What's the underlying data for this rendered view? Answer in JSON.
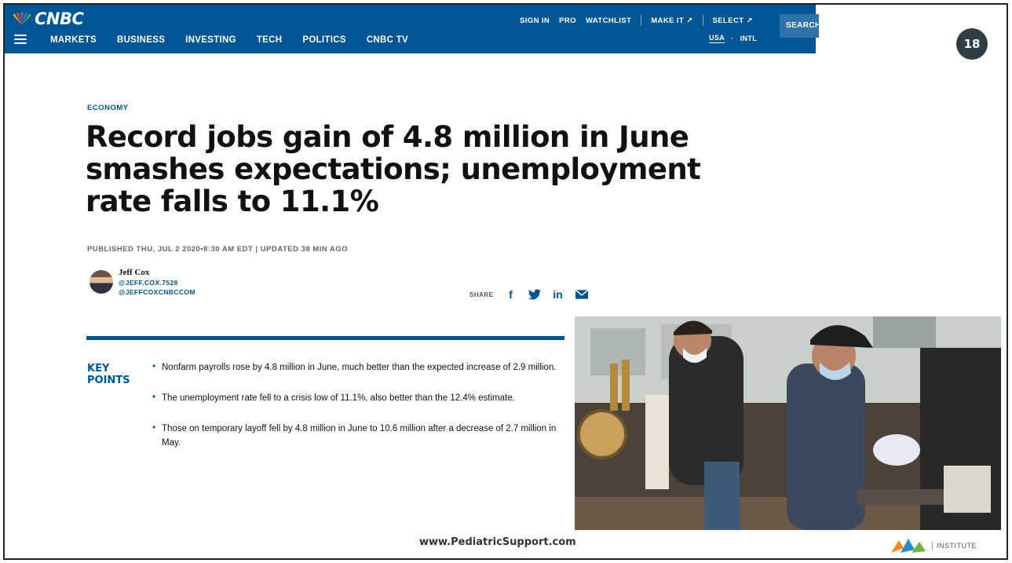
{
  "slide": {
    "number": "18",
    "footer_url": "www.PediatricSupport.com",
    "institute_label": "INSTITUTE"
  },
  "header": {
    "brand": "CNBC",
    "nav": [
      "MARKETS",
      "BUSINESS",
      "INVESTING",
      "TECH",
      "POLITICS",
      "CNBC TV"
    ],
    "top_links": [
      "SIGN IN",
      "PRO",
      "WATCHLIST",
      "MAKE IT ↗",
      "SELECT ↗"
    ],
    "search_label": "SEARCH",
    "regions": [
      "USA",
      "·",
      "INTL"
    ]
  },
  "article": {
    "section": "ECONOMY",
    "headline": "Record jobs gain of 4.8 million in June smashes expectations; unemployment rate falls to 11.1%",
    "published": "PUBLISHED THU, JUL 2 2020•8:30 AM EDT | UPDATED 38 MIN AGO",
    "author": {
      "name": "Jeff Cox",
      "handle1": "@JEFF.COX.7528",
      "handle2": "@JEFFCOXCNBCCOM"
    },
    "share": {
      "label": "SHARE",
      "icons": [
        "f",
        "t",
        "in",
        "✉"
      ]
    },
    "key_points": {
      "title": "KEY POINTS",
      "items": [
        "Nonfarm payrolls rose by 4.8 million in June, much better than the expected increase of 2.9 million.",
        "The unemployment rate fell to a crisis low of 11.1%, also better than the 12.4% estimate.",
        "Those on temporary layoff fell by 4.8 million in June to 10.6 million after a decrease of 2.7 million in May."
      ]
    }
  },
  "colors": {
    "brand_blue": "#005594",
    "search_blue": "#2f73ab",
    "slide_badge": "#2e3e44"
  }
}
